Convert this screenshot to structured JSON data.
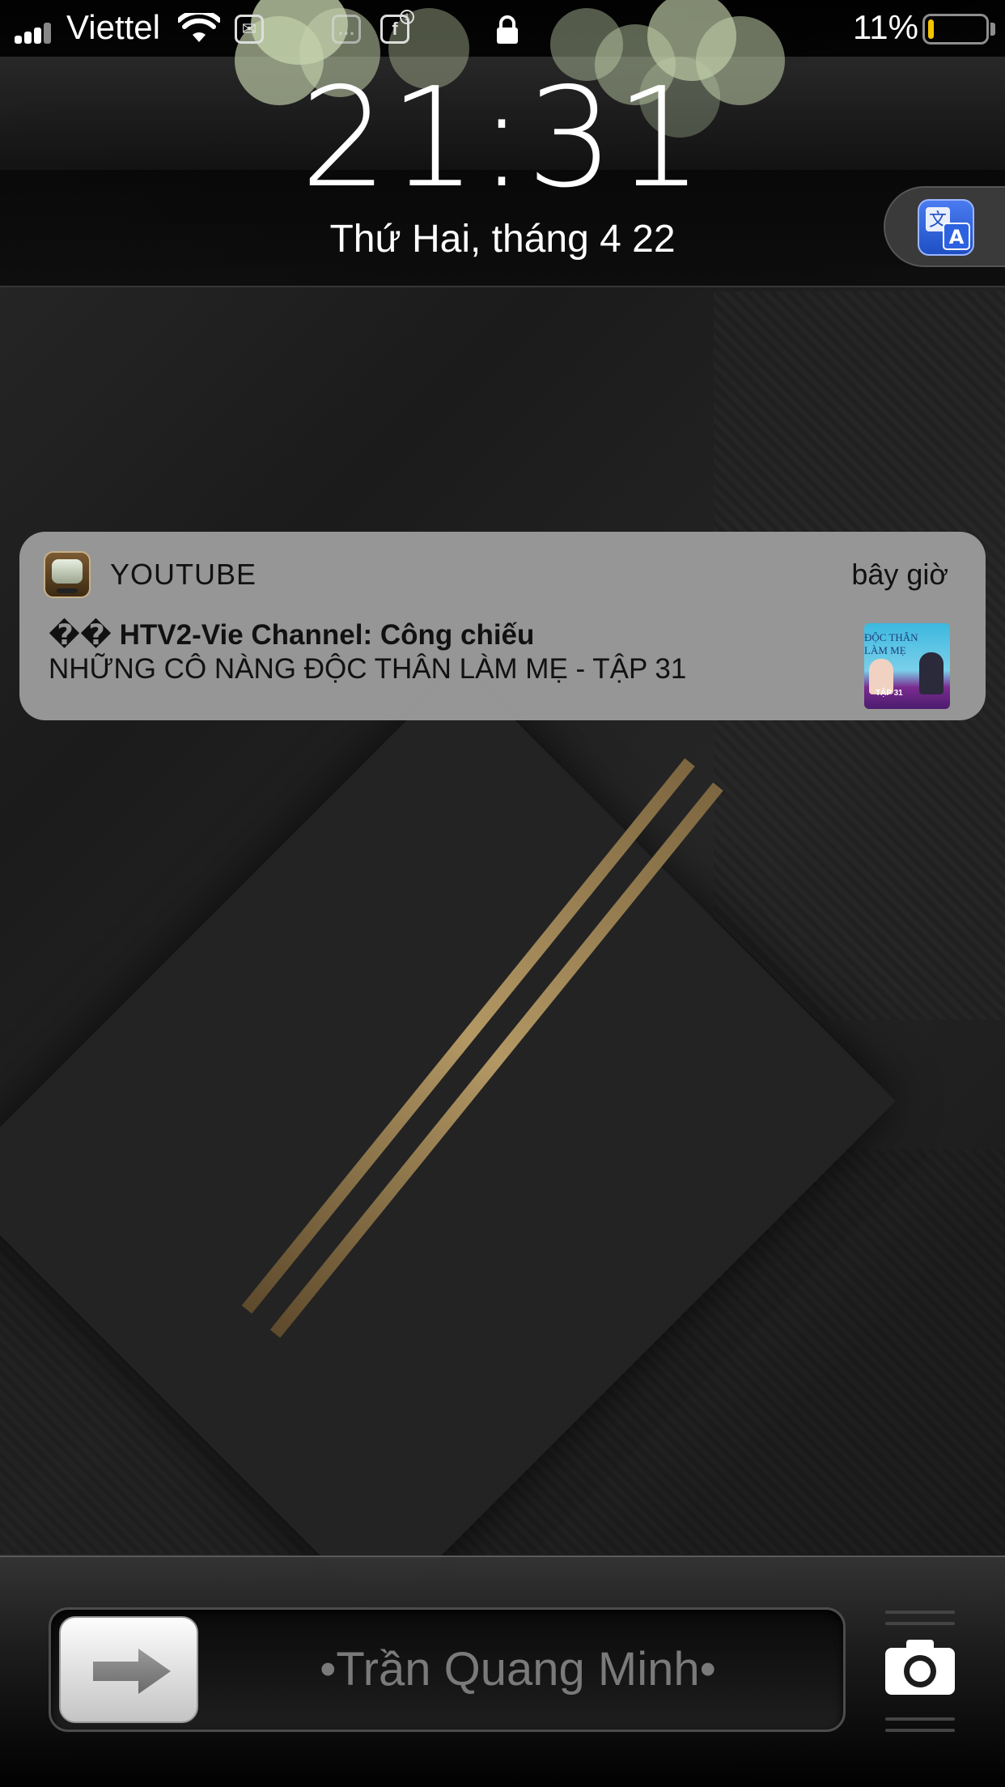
{
  "status_bar": {
    "carrier": "Viettel",
    "battery_percent_label": "11%",
    "battery_level": 0.11,
    "icons": [
      "signal-icon",
      "wifi-icon",
      "messenger-icon",
      "facebook-icon",
      "lock-icon",
      "battery-icon"
    ],
    "facebook_badge": "1"
  },
  "lock_screen": {
    "time": "21:31",
    "date": "Thứ Hai, tháng 4 22",
    "slider_label": "•Trần Quang Minh•"
  },
  "shortcut": {
    "icon": "translate-icon"
  },
  "notification": {
    "app_name": "YOUTUBE",
    "time": "bây giờ",
    "title": "�� HTV2-Vie Channel: Công chiếu",
    "body": "NHỮNG CÔ NÀNG ĐỘC THÂN LÀM MẸ - TẬP 31",
    "thumbnail": {
      "title_text": "ĐỘC THÂN LÀM MẸ",
      "episode_text": "TẬP 31"
    }
  },
  "colors": {
    "battery_fill": "#f4c400",
    "notification_bg": "#9b9b9b",
    "accent_gold": "#b39864"
  }
}
